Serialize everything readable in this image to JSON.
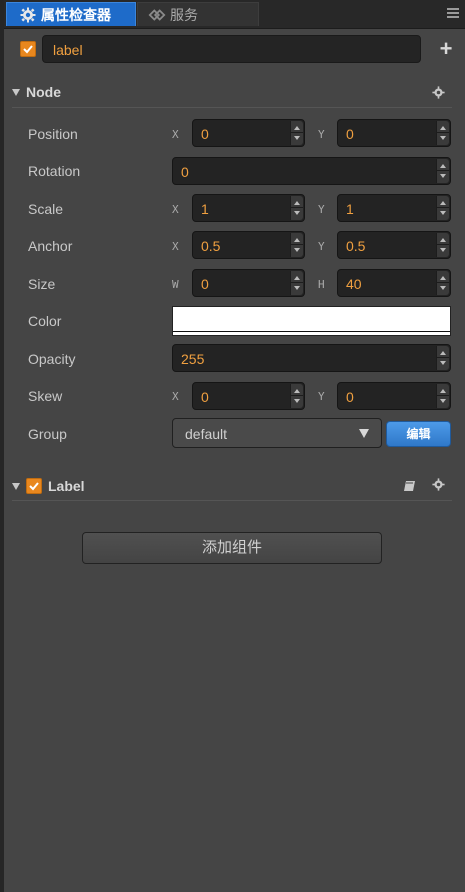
{
  "tabs": {
    "inspector_label": "属性检查器",
    "service_label": "服务"
  },
  "node_row": {
    "enabled": true,
    "name": "label"
  },
  "node_section": {
    "title": "Node",
    "properties": {
      "position": {
        "label": "Position",
        "x_axis": "X",
        "x": "0",
        "y_axis": "Y",
        "y": "0"
      },
      "rotation": {
        "label": "Rotation",
        "value": "0"
      },
      "scale": {
        "label": "Scale",
        "x_axis": "X",
        "x": "1",
        "y_axis": "Y",
        "y": "1"
      },
      "anchor": {
        "label": "Anchor",
        "x_axis": "X",
        "x": "0.5",
        "y_axis": "Y",
        "y": "0.5"
      },
      "size": {
        "label": "Size",
        "w_axis": "W",
        "w": "0",
        "h_axis": "H",
        "h": "40"
      },
      "color": {
        "label": "Color",
        "value": "#ffffff"
      },
      "opacity": {
        "label": "Opacity",
        "value": "255"
      },
      "skew": {
        "label": "Skew",
        "x_axis": "X",
        "x": "0",
        "y_axis": "Y",
        "y": "0"
      },
      "group": {
        "label": "Group",
        "value": "default",
        "edit_label": "编辑"
      }
    }
  },
  "label_section": {
    "title": "Label",
    "enabled": true
  },
  "add_component_label": "添加组件",
  "colors": {
    "accent_orange": "#f0a040",
    "tab_blue": "#1e6bc9",
    "edit_button_blue": "#3c86d8"
  }
}
